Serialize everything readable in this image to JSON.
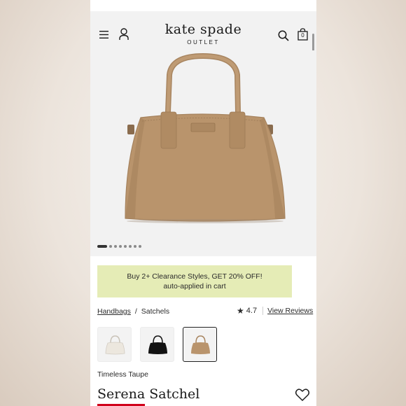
{
  "header": {
    "logo": "kate spade",
    "logo_sub": "OUTLET",
    "bag_count": "0",
    "icons": [
      "menu-icon",
      "account-icon",
      "search-icon",
      "bag-icon"
    ]
  },
  "gallery": {
    "image": "handbag-product-photo",
    "dot_count": 8,
    "active_dot": 0
  },
  "promo": {
    "line1": "Buy 2+ Clearance Styles, GET 20% OFF!",
    "line2": "auto-applied in cart"
  },
  "breadcrumb": {
    "items": [
      "Handbags",
      "Satchels"
    ],
    "separator": "/"
  },
  "rating": {
    "value": "4.7",
    "reviews_link": "View Reviews"
  },
  "swatches": [
    {
      "color": "#ece7de",
      "name": "white"
    },
    {
      "color": "#121212",
      "name": "black"
    },
    {
      "color": "#b9946c",
      "name": "taupe",
      "selected": true
    }
  ],
  "product": {
    "color_name": "Timeless Taupe",
    "title": "Serena Satchel"
  },
  "colors": {
    "promo_bg": "#e5ecb6",
    "bag_body": "#b9946c",
    "sale_accent": "#d0021b"
  }
}
